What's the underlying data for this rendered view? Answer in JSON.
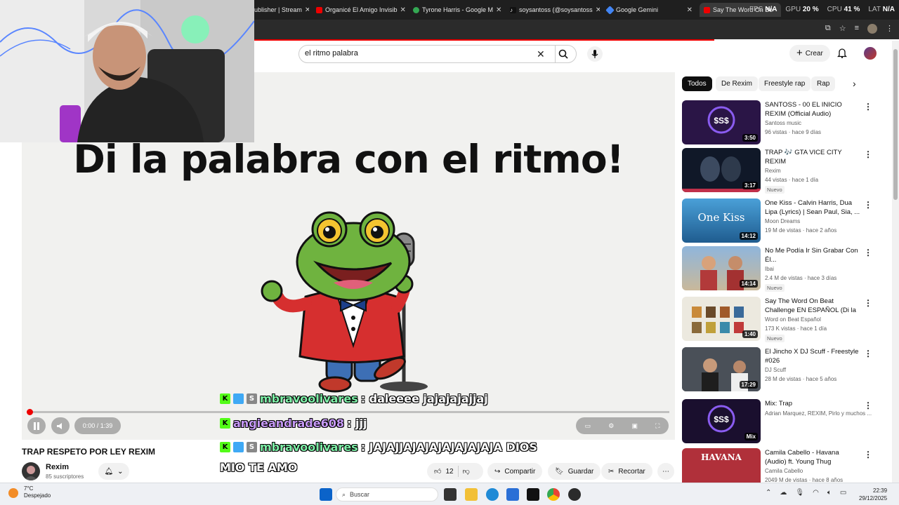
{
  "browser": {
    "tabs": [
      {
        "label": "ublisher | Stream",
        "color": "#5865f2"
      },
      {
        "label": "Organicé El Amigo Invisib",
        "color": "#e00"
      },
      {
        "label": "Tyrone Harris - Google M",
        "color": "#34a853"
      },
      {
        "label": "soysantoss (@soysantoss",
        "color": "#111111"
      },
      {
        "label": "Google Gemini",
        "color": "#4285f4"
      },
      {
        "label": "Say The Word On Be",
        "color": "#e00"
      }
    ],
    "stats": {
      "fps_label": "FPS",
      "fps_value": "N/A",
      "gpu_label": "GPU",
      "gpu_value": "20 %",
      "cpu_label": "CPU",
      "cpu_value": "41 %",
      "lat_label": "LAT",
      "lat_value": "N/A"
    }
  },
  "youtube": {
    "search_value": "el ritmo palabra",
    "create_label": "Crear",
    "chips": [
      "Todos",
      "De Rexim",
      "Freestyle rap",
      "Rap"
    ],
    "selected_chip": "Todos"
  },
  "video": {
    "overlay_title": "Di la palabra con el ritmo!",
    "time": "0:00 / 1:39",
    "progress": 0.0,
    "title": "TRAP RESPETO POR LEY REXIM",
    "channel": "Rexim",
    "subscribers": "85 suscriptores",
    "likes": "12",
    "share_label": "Compartir",
    "save_label": "Guardar",
    "clip_label": "Recortar"
  },
  "chat": [
    {
      "user": "mbravoolivares",
      "text": ": daleeee jajajajajjaj"
    },
    {
      "user": "angieandrade608",
      "text": ": jjj"
    },
    {
      "user": "mbravoolivares",
      "text": ": JAJAJJAJAJAJAJAJAJAJA DIOS",
      "text2": "MIO TE AMO"
    }
  ],
  "recommended": [
    {
      "title": "SANTOSS - 00 EL INICIO REXIM (Official Audio)",
      "channel": "Santoss music",
      "meta": "96 vistas · hace 9 días",
      "duration": "3:50",
      "thumb": "#2a1546",
      "badge": ""
    },
    {
      "title": "TRAP 🎶 GTA VICE CITY REXIM",
      "channel": "Rexim",
      "meta": "44 vistas · hace 1 día",
      "duration": "3:17",
      "thumb": "#101828",
      "badge": "Nuevo"
    },
    {
      "title": "One Kiss - Calvin Harris, Dua Lipa (Lyrics) | Sean Paul, Sia, ...",
      "channel": "Moon Dreams",
      "meta": "19 M de vistas · hace 2 años",
      "duration": "14:12",
      "thumb": "#2f7bb4",
      "badge": "",
      "thumb_text": "One Kiss"
    },
    {
      "title": "No Me Podía Ir Sin Grabar Con Él...",
      "channel": "Ibai",
      "meta": "2.4 M de vistas · hace 3 días",
      "duration": "14:14",
      "thumb": "#6b8fb0",
      "badge": "Nuevo"
    },
    {
      "title": "Say The Word On Beat Challenge EN ESPAÑOL (Di la ...",
      "channel": "Word on Beat Español",
      "meta": "173 K vistas · hace 1 día",
      "duration": "1:40",
      "thumb": "#e9e6dc",
      "badge": "Nuevo"
    },
    {
      "title": "El Jincho X DJ Scuff - Freestyle #026",
      "channel": "DJ Scuff",
      "meta": "28 M de vistas · hace 5 años",
      "duration": "17:29",
      "thumb": "#3a3f44",
      "badge": ""
    },
    {
      "title": "Mix: Trap",
      "channel": "Adrian Marquez, REXIM, Pirlo y muchos ...",
      "meta": "",
      "duration": "Mix",
      "thumb": "#1a0f2e",
      "badge": ""
    },
    {
      "title": "Camila Cabello - Havana (Audio) ft. Young Thug",
      "channel": "Camila Cabello",
      "meta": "2049 M de vistas · hace 8 años",
      "duration": "",
      "thumb": "#b0303a",
      "badge": "",
      "thumb_text": "HAVANA"
    }
  ],
  "taskbar": {
    "temp": "7°C",
    "weather": "Despejado",
    "search_placeholder": "Buscar",
    "time": "22:39",
    "date": "29/12/2025"
  }
}
